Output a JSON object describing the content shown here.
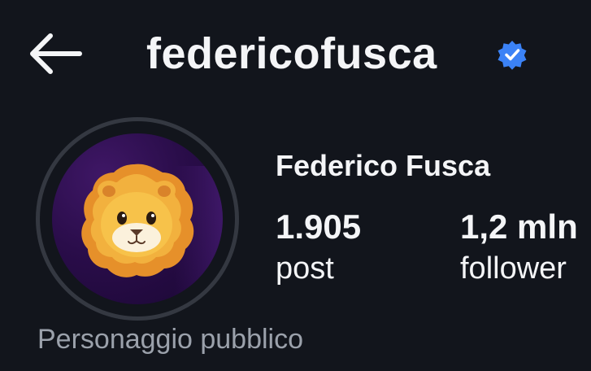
{
  "header": {
    "back_icon": "arrow-left-icon",
    "username": "federicofusca",
    "verified_icon": "verified-badge-icon",
    "verified_color": "#3b82f6"
  },
  "profile": {
    "avatar_icon": "lion-face-icon",
    "full_name": "Federico Fusca",
    "stats": [
      {
        "value": "1.905",
        "label": "post"
      },
      {
        "value": "1,2 mln",
        "label": "follower"
      }
    ],
    "category": "Personaggio pubblico"
  },
  "colors": {
    "background": "#12151c",
    "text": "#f4f5f7",
    "muted_text": "#9ba1ab",
    "avatar_ring": "#343841"
  }
}
